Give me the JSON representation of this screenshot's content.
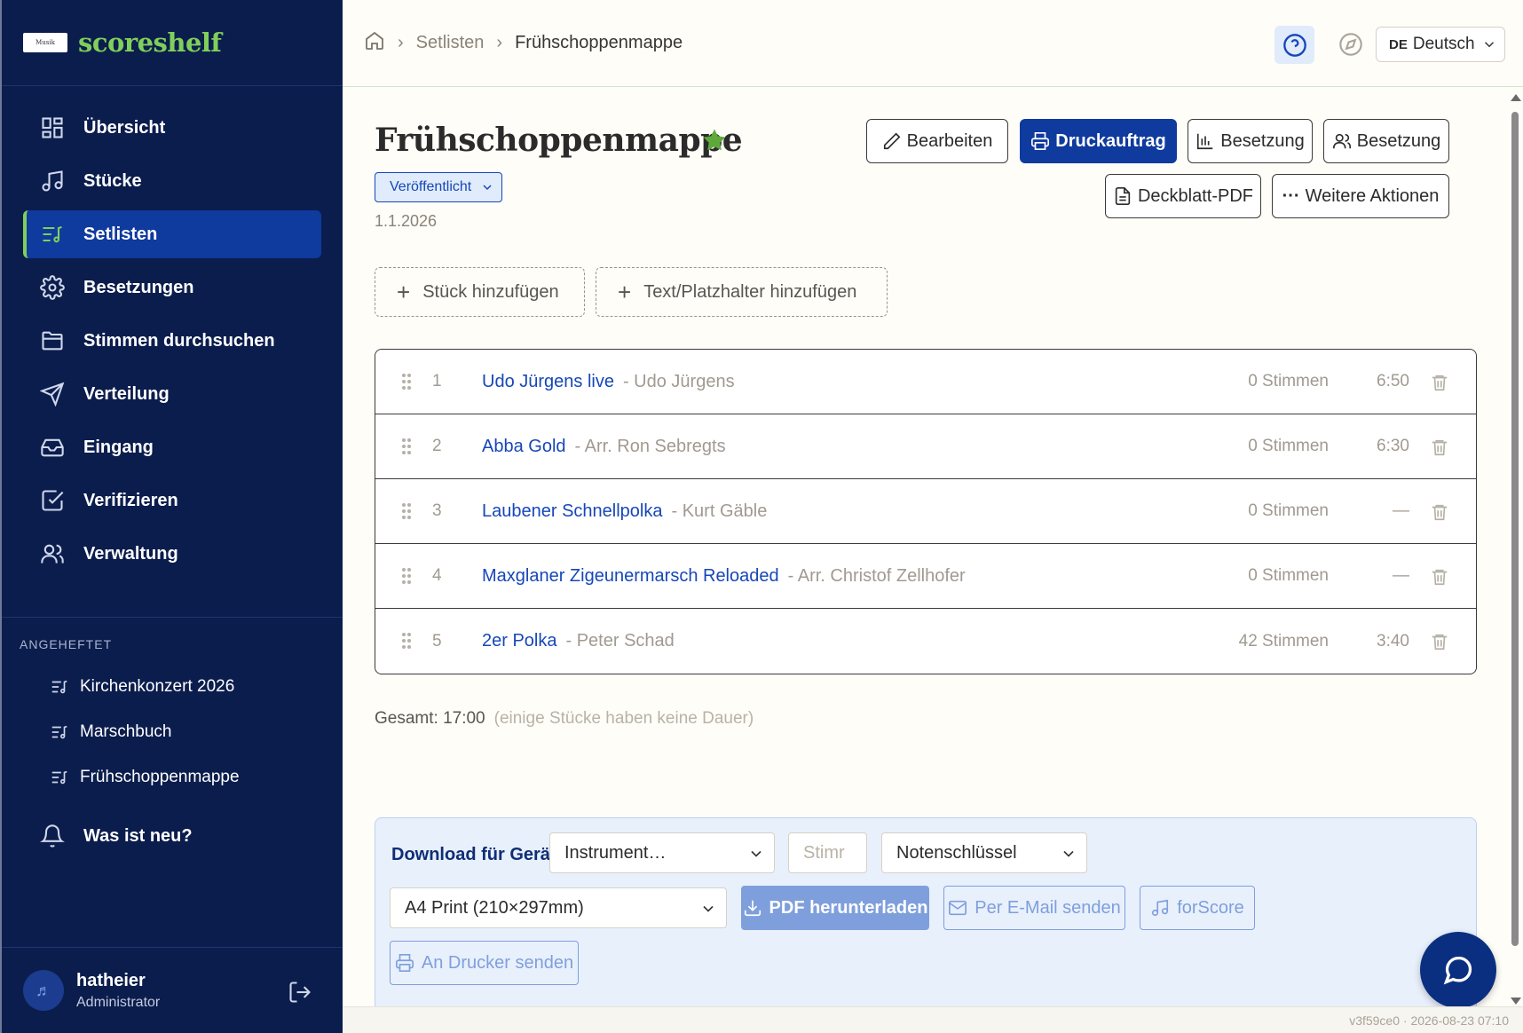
{
  "brand": {
    "name": "scoreshelf",
    "logo_text": "Musik"
  },
  "sidebar": {
    "items": [
      {
        "label": "Übersicht",
        "icon": "grid-icon"
      },
      {
        "label": "Stücke",
        "icon": "music-note-icon"
      },
      {
        "label": "Setlisten",
        "icon": "setlist-icon",
        "active": true
      },
      {
        "label": "Besetzungen",
        "icon": "gear-icon"
      },
      {
        "label": "Stimmen durchsuchen",
        "icon": "folder-icon"
      },
      {
        "label": "Verteilung",
        "icon": "send-icon"
      },
      {
        "label": "Eingang",
        "icon": "inbox-icon"
      },
      {
        "label": "Verifizieren",
        "icon": "check-square-icon"
      },
      {
        "label": "Verwaltung",
        "icon": "users-icon"
      }
    ],
    "pinned_label": "ANGEHEFTET",
    "pinned": [
      "Kirchenkonzert 2026",
      "Marschbuch",
      "Frühschoppenmappe"
    ],
    "news": "Was ist neu?",
    "user": {
      "name": "hatheier",
      "role": "Administrator"
    }
  },
  "breadcrumb": {
    "parent": "Setlisten",
    "current": "Frühschoppenmappe"
  },
  "lang": {
    "code": "DE",
    "label": "Deutsch"
  },
  "setlist": {
    "title": "Frühschoppenmappe",
    "status": "Veröffentlicht",
    "date": "1.1.2026",
    "actions": {
      "edit": "Bearbeiten",
      "print": "Druckauftrag",
      "instrumentation_chart": "Besetzung",
      "instrumentation_people": "Besetzung",
      "cover_pdf": "Deckblatt-PDF",
      "more": "Weitere Aktionen"
    },
    "add_piece": "Stück hinzufügen",
    "add_text": "Text/Platzhalter hinzufügen",
    "rows": [
      {
        "num": "1",
        "name": "Udo Jürgens live",
        "composer": "- Udo Jürgens",
        "voices": "0 Stimmen",
        "duration": "6:50"
      },
      {
        "num": "2",
        "name": "Abba Gold",
        "composer": "- Arr. Ron Sebregts",
        "voices": "0 Stimmen",
        "duration": "6:30"
      },
      {
        "num": "3",
        "name": "Laubener Schnellpolka",
        "composer": "- Kurt Gäble",
        "voices": "0 Stimmen",
        "duration": "—"
      },
      {
        "num": "4",
        "name": "Maxglaner Zigeunermarsch Reloaded",
        "composer": "- Arr. Christof Zellhofer",
        "voices": "0 Stimmen",
        "duration": "—"
      },
      {
        "num": "5",
        "name": "2er Polka",
        "composer": "- Peter Schad",
        "voices": "42 Stimmen",
        "duration": "3:40"
      }
    ],
    "total": "Gesamt: 17:00",
    "total_note": "(einige Stücke haben keine Dauer)"
  },
  "download": {
    "label": "Download für Gerät:",
    "instrument": "Instrument…",
    "voice_placeholder": "Stimr",
    "clef": "Notenschlüssel",
    "format": "A4 Print (210×297mm)",
    "pdf": "PDF herunterladen",
    "email": "Per E-Mail senden",
    "forscore": "forScore",
    "printer": "An Drucker senden"
  },
  "footer": "v3f59ce0 · 2026-08-23 07:10",
  "colors": {
    "sidebar": "#0b1d4d",
    "accent": "#0f3a9e",
    "brand": "#7fcf5a",
    "link": "#1647b8"
  }
}
